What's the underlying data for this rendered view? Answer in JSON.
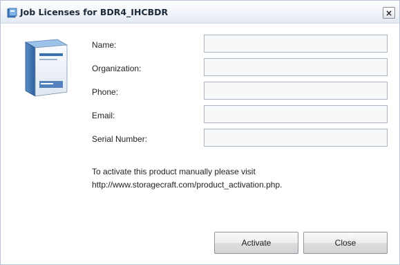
{
  "window": {
    "title": "Job Licenses for BDR4_IHCBDR",
    "close_label": "×"
  },
  "form": {
    "fields": [
      {
        "label": "Name:",
        "value": ""
      },
      {
        "label": "Organization:",
        "value": ""
      },
      {
        "label": "Phone:",
        "value": ""
      },
      {
        "label": "Email:",
        "value": ""
      },
      {
        "label": "Serial Number:",
        "value": ""
      }
    ]
  },
  "note": {
    "line1": "To activate this product manually please visit",
    "line2": "http://www.storagecraft.com/product_activation.php."
  },
  "buttons": {
    "activate": "Activate",
    "close": "Close"
  },
  "icons": {
    "app": "app-icon",
    "product": "software-box-icon",
    "close": "close-icon"
  }
}
